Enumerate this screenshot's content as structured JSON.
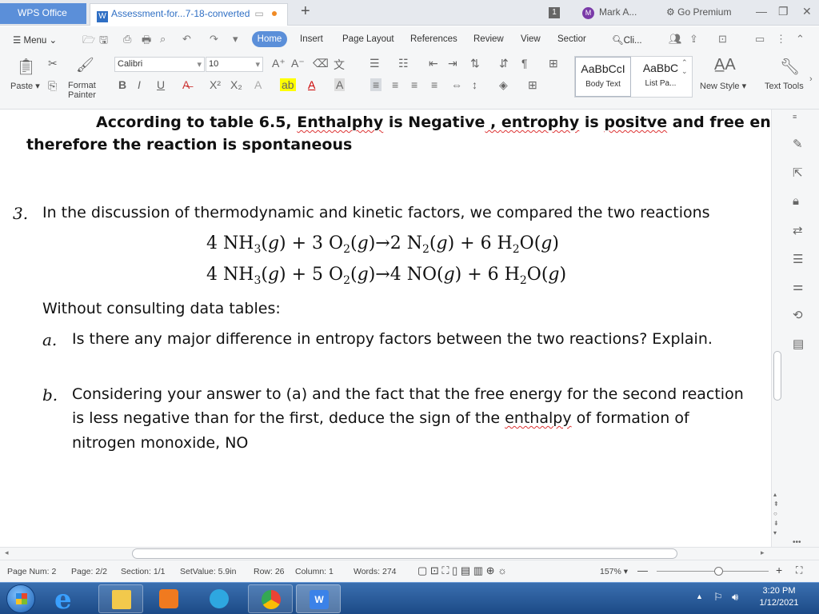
{
  "titlebar": {
    "app_tab": "WPS Office",
    "doc_tab": "Assessment-for...7-18-converted",
    "tab_count": "1",
    "user_initial": "M",
    "user_name": "Mark A...",
    "premium": "Go Premium"
  },
  "menu": {
    "menu_label": "Menu",
    "tabs": [
      "Home",
      "Insert",
      "Page Layout",
      "References",
      "Review",
      "View",
      "Sectior"
    ],
    "search": "Cli..."
  },
  "ribbon": {
    "paste": "Paste",
    "format_painter_1": "Format",
    "format_painter_2": "Painter",
    "font_name": "Calibri",
    "font_size": "10",
    "styles": [
      {
        "preview": "AaBbCcI",
        "name": "Body Text"
      },
      {
        "preview": "AaBbC",
        "name": "List Pa..."
      }
    ],
    "new_style": "New Style",
    "text_tools": "Text Tools"
  },
  "document": {
    "conclusion_1_pre": "According to table 6.5, ",
    "conclusion_1_w1": "Enthalphy",
    "conclusion_1_mid1": " is Negative",
    "conclusion_1_w2": " , ",
    "conclusion_1_w3": "entrophy",
    "conclusion_1_mid2": " is ",
    "conclusion_1_w4": "positve",
    "conclusion_1_post": " and free energy is neg",
    "conclusion_2": "therefore the reaction is spontaneous",
    "q3_number": "3.",
    "q3_text": "In the discussion of thermodynamic and kinetic factors, we compared the two reactions",
    "eq1": "4 NH3(g) + 3 O2(g) → 2 N2(g) + 6 H2O(g)",
    "eq2": "4 NH3(g) + 5 O2(g) → 4 NO(g) + 6 H2O(g)",
    "instruction": "Without consulting data tables:",
    "qa_label": "a.",
    "qa_text": "Is there any major difference in entropy factors between the two reactions? Explain.",
    "qb_label": "b.",
    "qb_line1": "Considering your answer to (a) and the fact that the free energy for the second reaction",
    "qb_line2_pre": "is less negative than for the first, deduce the sign of the ",
    "qb_line2_word": "enthalpy",
    "qb_line2_post": " of formation of",
    "qb_line3": "nitrogen monoxide, NO"
  },
  "status": {
    "page_num": "Page Num: 2",
    "page": "Page: 2/2",
    "section": "Section: 1/1",
    "set_value": "SetValue: 5.9in",
    "row": "Row: 26",
    "column": "Column: 1",
    "words": "Words: 274",
    "zoom": "157%"
  },
  "taskbar": {
    "time": "3:20 PM",
    "date": "1/12/2021"
  },
  "colors": {
    "accent": "#5b8fd9",
    "taskbar": "#1c4a86"
  }
}
